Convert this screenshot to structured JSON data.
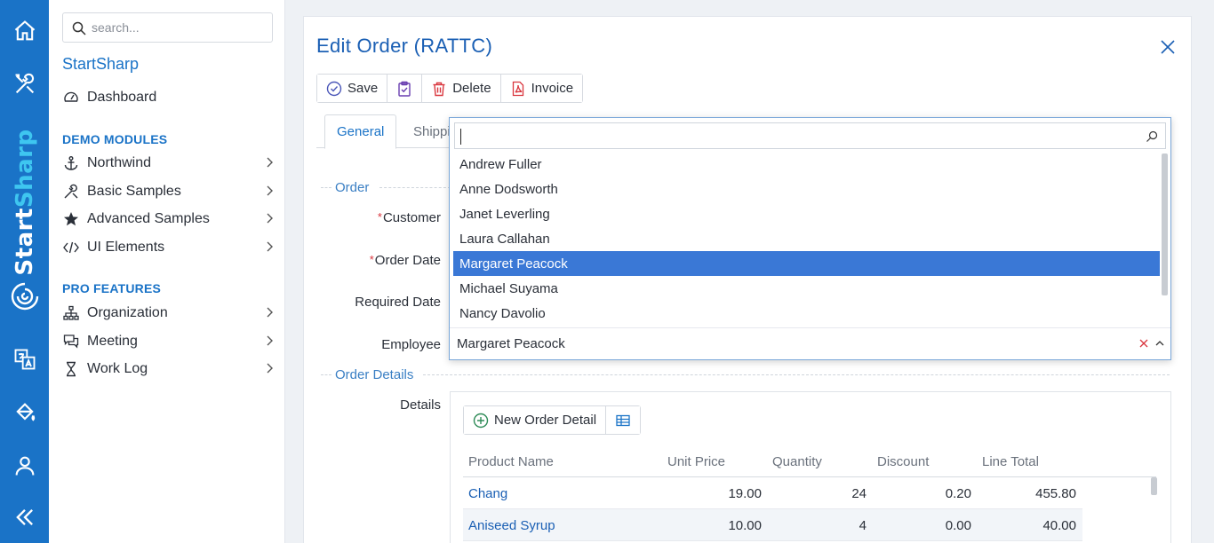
{
  "rail": {
    "brand_part1": "Start",
    "brand_part2": "Sharp"
  },
  "sidebar": {
    "search_placeholder": "search...",
    "brand": "StartSharp",
    "dashboard": "Dashboard",
    "demo_title": "DEMO MODULES",
    "demo_items": [
      "Northwind",
      "Basic Samples",
      "Advanced Samples",
      "UI Elements"
    ],
    "pro_title": "PRO FEATURES",
    "pro_items": [
      "Organization",
      "Meeting",
      "Work Log"
    ]
  },
  "dialog": {
    "title": "Edit Order (RATTC)",
    "toolbar": {
      "save": "Save",
      "delete": "Delete",
      "invoice": "Invoice"
    },
    "tabs": [
      "General",
      "Shippi"
    ],
    "fieldset_order": "Order",
    "labels": {
      "customer": "Customer",
      "order_date": "Order Date",
      "required_date": "Required Date",
      "employee": "Employee",
      "details": "Details"
    },
    "fieldset_details": "Order Details"
  },
  "dropdown": {
    "options": [
      "Andrew Fuller",
      "Anne Dodsworth",
      "Janet Leverling",
      "Laura Callahan",
      "Margaret Peacock",
      "Michael Suyama",
      "Nancy Davolio"
    ],
    "selected_index": 4,
    "value": "Margaret Peacock"
  },
  "details_grid": {
    "new_button": "New Order Detail",
    "columns": [
      "Product Name",
      "Unit Price",
      "Quantity",
      "Discount",
      "Line Total"
    ],
    "rows": [
      [
        "Chang",
        "19.00",
        "24",
        "0.20",
        "455.80"
      ],
      [
        "Aniseed Syrup",
        "10.00",
        "4",
        "0.00",
        "40.00"
      ]
    ]
  },
  "colors": {
    "rail": "#1a73c7",
    "accent": "#1a73c7",
    "selected": "#3a78d6",
    "brand_highlight": "#3ec6f0"
  }
}
